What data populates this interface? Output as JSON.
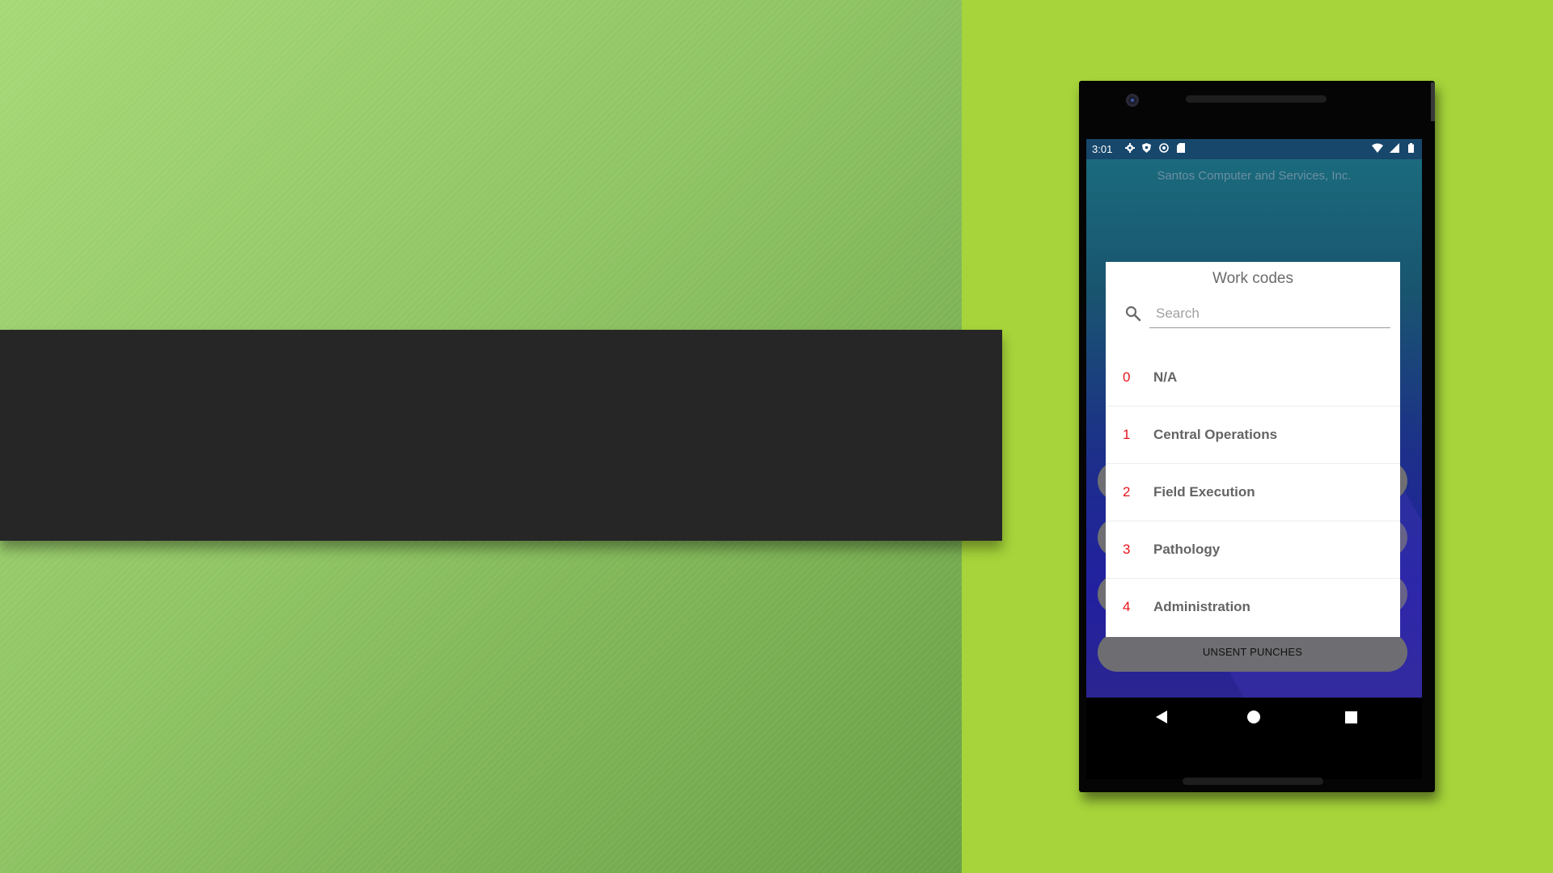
{
  "status_bar": {
    "time": "3:01",
    "left_icons": [
      "settings-icon",
      "shield-icon",
      "sync-icon",
      "sd-card-icon"
    ],
    "right_icons": [
      "wifi-icon",
      "signal-icon",
      "battery-icon"
    ]
  },
  "app": {
    "company_name": "Santos Computer and Services, Inc.",
    "unsent_button_label": "UNSENT PUNCHES"
  },
  "dialog": {
    "title": "Work codes",
    "search": {
      "placeholder": "Search",
      "value": ""
    },
    "items": [
      {
        "code": "0",
        "name": "N/A"
      },
      {
        "code": "1",
        "name": "Central Operations"
      },
      {
        "code": "2",
        "name": "Field Execution"
      },
      {
        "code": "3",
        "name": "Pathology"
      },
      {
        "code": "4",
        "name": "Administration"
      }
    ]
  },
  "nav": {
    "back_icon": "back-triangle-icon",
    "home_icon": "home-circle-icon",
    "recents_icon": "recents-square-icon"
  },
  "colors": {
    "slide_accent": "#a6d43a",
    "title_band": "#262626",
    "code_number": "#e8141c",
    "code_name": "#646464"
  }
}
